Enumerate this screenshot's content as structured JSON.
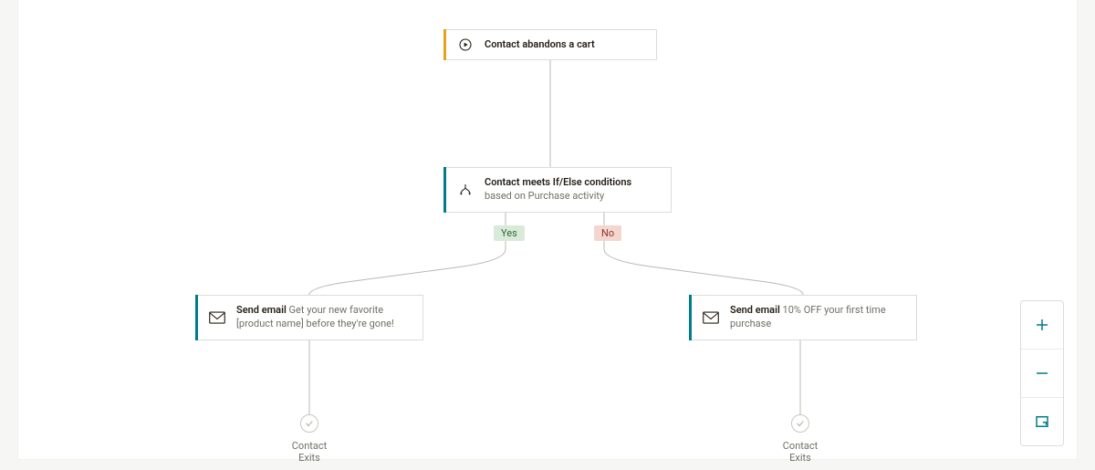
{
  "trigger": {
    "label": "Contact abandons a cart",
    "icon_name": "play-circle-icon",
    "accent_color": "#e7a11a"
  },
  "ifelse": {
    "label_bold": "Contact meets If/Else conditions",
    "label_muted": " based on Purchase activity",
    "icon_name": "split-icon",
    "accent_color": "#007c89"
  },
  "branch": {
    "yes": "Yes",
    "no": "No"
  },
  "email_left": {
    "label_bold": "Send email",
    "label_muted": " Get your new favorite [product name] before they're gone!",
    "icon_name": "mail-icon",
    "accent_color": "#007c89"
  },
  "email_right": {
    "label_bold": "Send email",
    "label_muted": " 10% OFF your first time purchase",
    "icon_name": "mail-icon",
    "accent_color": "#007c89"
  },
  "exit": {
    "left": "Contact Exits",
    "right": "Contact Exits",
    "icon_name": "check-circle-icon"
  },
  "zoom": {
    "in_name": "zoom-in-button",
    "out_name": "zoom-out-button",
    "fit_name": "zoom-fit-button"
  },
  "colors": {
    "teal": "#007c89",
    "yes_bg": "#d9ead9",
    "no_bg": "#f4d6cf",
    "line": "#b9b8b2"
  }
}
